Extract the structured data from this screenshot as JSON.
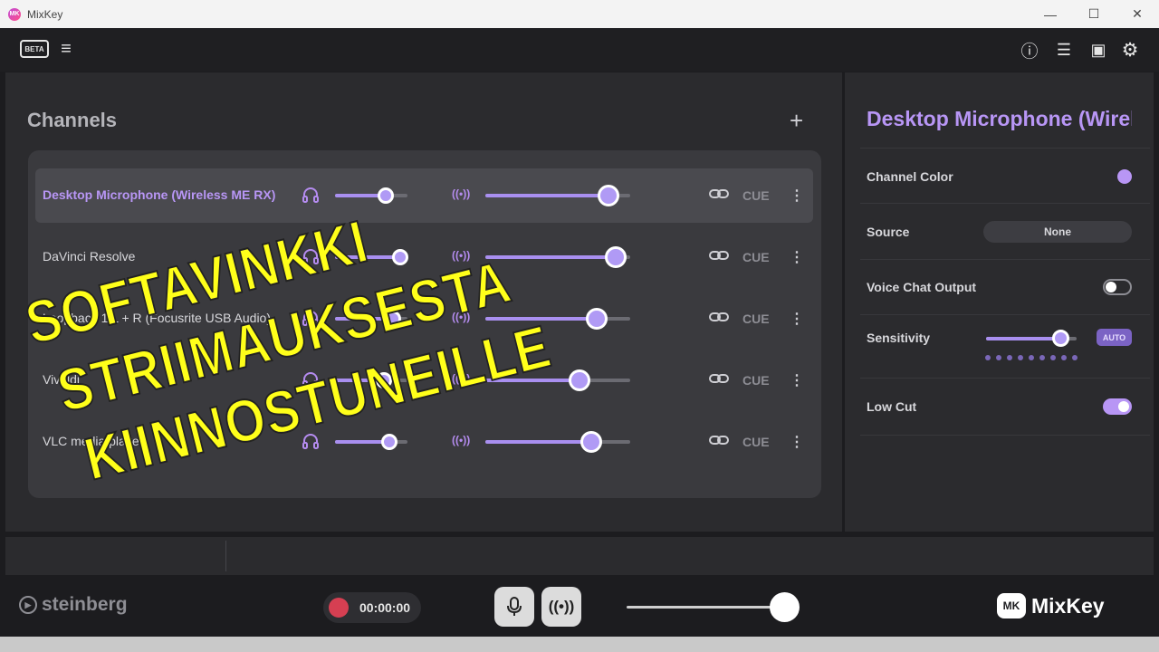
{
  "window": {
    "title": "MixKey",
    "minimize": "—",
    "maximize": "☐",
    "close": "✕"
  },
  "topbar": {
    "beta_label": "BETA",
    "menu_icon": "hamburger-icon",
    "info_icon": "ⓘ",
    "list_icon": "☰",
    "panel_icon": "▣",
    "settings_icon": "⚙"
  },
  "channels": {
    "title": "Channels",
    "add_icon": "+",
    "cue_label": "CUE",
    "rows": [
      {
        "name": "Desktop Microphone (Wireless ME RX)",
        "monitor_level": 0.7,
        "stream_level": 0.85,
        "active": true
      },
      {
        "name": "DaVinci Resolve",
        "monitor_level": 0.9,
        "stream_level": 0.9,
        "active": false
      },
      {
        "name": "Loopback 1 L + R (Focusrite USB Audio)",
        "monitor_level": 0.8,
        "stream_level": 0.77,
        "active": false
      },
      {
        "name": "Vivaldi",
        "monitor_level": 0.67,
        "stream_level": 0.65,
        "active": false
      },
      {
        "name": "VLC media player",
        "monitor_level": 0.75,
        "stream_level": 0.73,
        "active": false
      }
    ]
  },
  "panel": {
    "title": "Desktop Microphone (Wireless ME RX)",
    "channel_color_label": "Channel Color",
    "channel_color": "#b896f5",
    "source_label": "Source",
    "source_value": "None",
    "voice_chat_label": "Voice Chat Output",
    "voice_chat_on": false,
    "sensitivity_label": "Sensitivity",
    "sensitivity_level": 0.82,
    "auto_label": "AUTO",
    "low_cut_label": "Low Cut",
    "low_cut_on": true
  },
  "bottom": {
    "brand": "steinberg",
    "record_time": "00:00:00",
    "mic_icon": "microphone-icon",
    "broadcast_icon": "broadcast-icon",
    "master_level": 0.94,
    "logo_text": "MixKey",
    "logo_badge": "MK"
  },
  "overlay": {
    "line1": "SOFTAVINKKI",
    "line2": "STRIIMAUKSESTA",
    "line3": "KIINNOSTUNEILLE"
  },
  "colors": {
    "accent": "#b896f5",
    "record": "#d63f52",
    "overlay_text": "#ffff1a"
  }
}
